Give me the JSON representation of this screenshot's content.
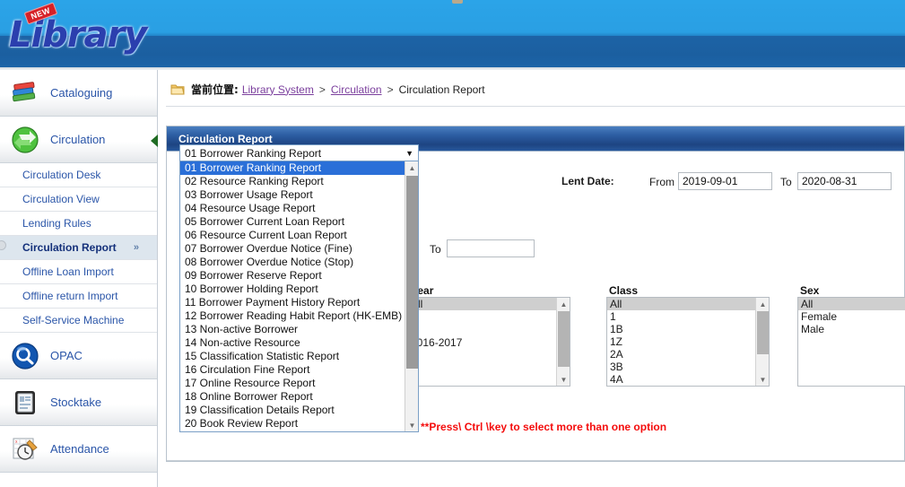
{
  "app": {
    "logo_text": "Library",
    "logo_tag": "NEW"
  },
  "breadcrumb": {
    "icon": "folder-icon",
    "prefix": "當前位置:",
    "links": [
      "Library System",
      "Circulation"
    ],
    "separator": ">",
    "current": "Circulation Report"
  },
  "sidebar": {
    "major": [
      {
        "label": "Cataloguing",
        "icon": "books-icon"
      },
      {
        "label": "Circulation",
        "icon": "recycle-arrows-icon"
      },
      {
        "label": "OPAC",
        "icon": "magnifier-icon"
      },
      {
        "label": "Stocktake",
        "icon": "clipboard-icon"
      },
      {
        "label": "Attendance",
        "icon": "calendar-clock-icon"
      }
    ],
    "circulation_items": [
      {
        "label": "Circulation Desk",
        "active": false
      },
      {
        "label": "Circulation View",
        "active": false
      },
      {
        "label": "Lending Rules",
        "active": false
      },
      {
        "label": "Circulation Report",
        "active": true,
        "chevron": "»"
      },
      {
        "label": "Offline Loan Import",
        "active": false
      },
      {
        "label": "Offline return Import",
        "active": false
      },
      {
        "label": "Self-Service Machine",
        "active": false
      }
    ]
  },
  "panel": {
    "title": "Circulation Report"
  },
  "report_select": {
    "selected": "01 Borrower Ranking Report",
    "caret": "▼",
    "options": [
      "01 Borrower Ranking Report",
      "02 Resource Ranking Report",
      "03 Borrower Usage Report",
      "04 Resource Usage Report",
      "05 Borrower Current Loan Report",
      "06 Resource Current Loan Report",
      "07 Borrower Overdue Notice (Fine)",
      "08 Borrower Overdue Notice (Stop)",
      "09 Borrower Reserve Report",
      "10 Borrower Holding Report",
      "11 Borrower Payment History Report",
      "12 Borrower Reading Habit Report (HK-EMB)",
      "13 Non-active Borrower",
      "14 Non-active Resource",
      "15 Classification Statistic Report",
      "16 Circulation Fine Report",
      "17 Online Resource Report",
      "18 Online Borrower Report",
      "19 Classification Details Report",
      "20 Book Review Report"
    ]
  },
  "lent_date": {
    "label": "Lent Date:",
    "from_label": "From",
    "from_value": "2019-09-01",
    "to_label": "To",
    "to_value": "2020-08-31"
  },
  "second_row": {
    "to_label": "To",
    "to_value": ""
  },
  "filters": {
    "year": {
      "label": "Year",
      "options": [
        "All",
        "",
        "",
        "2016-2017"
      ],
      "selected": "All"
    },
    "class": {
      "label": "Class",
      "options": [
        "All",
        "1",
        "1B",
        "1Z",
        "2A",
        "3B",
        "4A"
      ],
      "selected": "All"
    },
    "sex": {
      "label": "Sex",
      "options": [
        "All",
        "Female",
        "Male"
      ],
      "selected": "All"
    }
  },
  "hint": {
    "text": "**Press\\ Ctrl \\key to select more than one option"
  },
  "colors": {
    "banner_top": "#2ba4e8",
    "banner_bottom": "#1b5fa0",
    "panel_header": "#1d4482",
    "link": "#2a55a8",
    "breadcrumb_link": "#7b3f9d",
    "option_selected": "#2a6fd8",
    "hint_red": "#f40d0d"
  }
}
